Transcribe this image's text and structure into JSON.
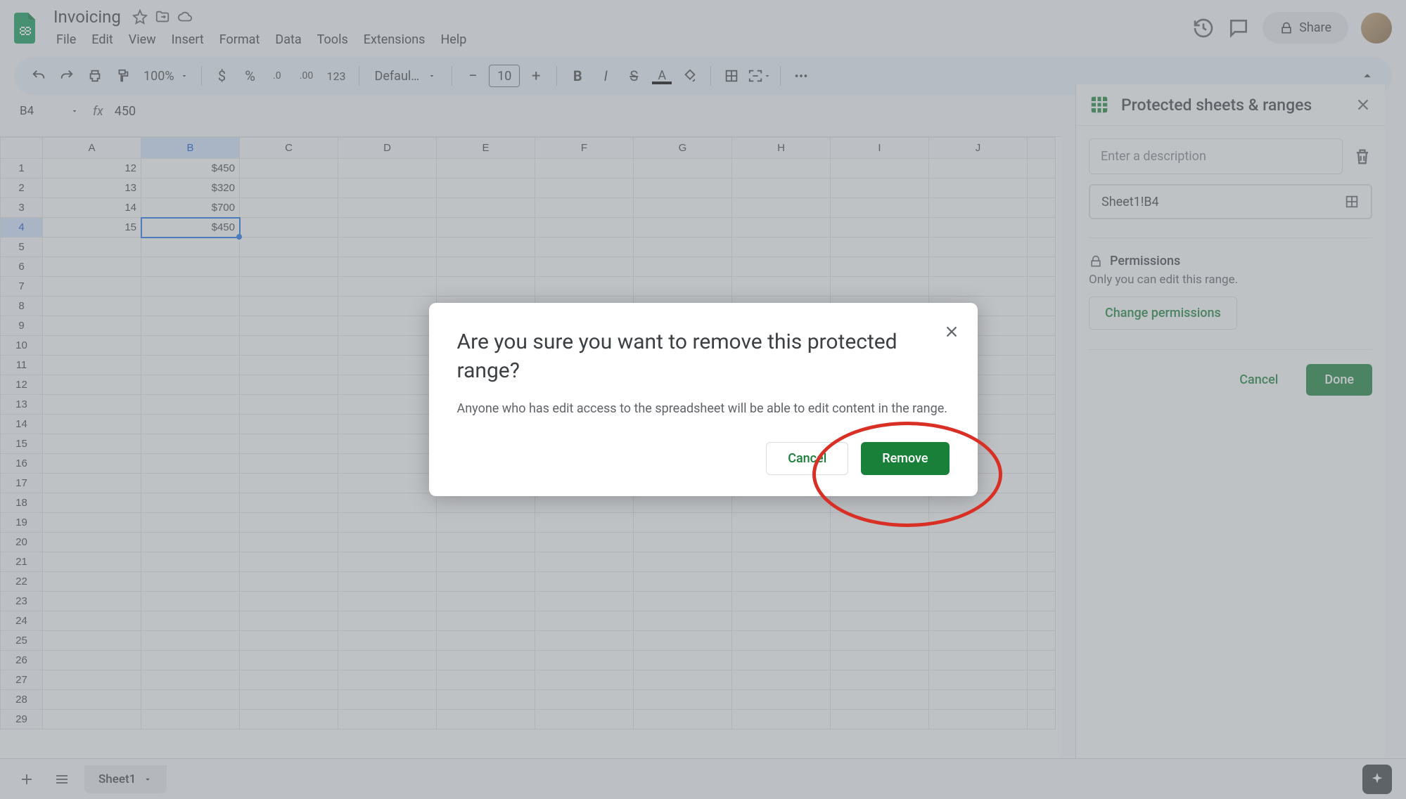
{
  "doc": {
    "title": "Invoicing"
  },
  "menubar": [
    "File",
    "Edit",
    "View",
    "Insert",
    "Format",
    "Data",
    "Tools",
    "Extensions",
    "Help"
  ],
  "header": {
    "share": "Share"
  },
  "toolbar": {
    "zoom": "100%",
    "format_123": "123",
    "font": "Defaul…",
    "font_size": "10"
  },
  "name_box": "B4",
  "formula": "450",
  "columns": [
    "A",
    "B",
    "C",
    "D",
    "E",
    "F",
    "G",
    "H",
    "I",
    "J"
  ],
  "row_count": 29,
  "cells": {
    "r1": {
      "A": "12",
      "B": "$450"
    },
    "r2": {
      "A": "13",
      "B": "$320"
    },
    "r3": {
      "A": "14",
      "B": "$700"
    },
    "r4": {
      "A": "15",
      "B": "$450"
    }
  },
  "selected": {
    "row": 4,
    "col": "B"
  },
  "sidebar": {
    "title": "Protected sheets & ranges",
    "desc_placeholder": "Enter a description",
    "range": "Sheet1!B4",
    "perm_title": "Permissions",
    "perm_desc": "Only you can edit this range.",
    "change_perm": "Change permissions",
    "cancel": "Cancel",
    "done": "Done"
  },
  "tabs": {
    "sheet1": "Sheet1"
  },
  "dialog": {
    "title": "Are you sure you want to remove this protected range?",
    "body": "Anyone who has edit access to the spreadsheet will be able to edit content in the range.",
    "cancel": "Cancel",
    "remove": "Remove"
  }
}
